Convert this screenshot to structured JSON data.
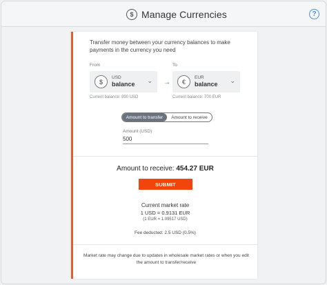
{
  "header": {
    "title": "Manage Currencies",
    "icon": "currency-exchange-icon",
    "help_icon": "help-icon"
  },
  "intro_text": "Transfer money between your currency balances to make payments in the currency you need",
  "from": {
    "label": "From",
    "symbol": "$",
    "code": "USD",
    "balance_label": "balance",
    "current_balance": "Current balance: 990 USD"
  },
  "to": {
    "label": "To",
    "symbol": "€",
    "code": "EUR",
    "balance_label": "balance",
    "current_balance": "Current balance: 700 EUR"
  },
  "toggle": {
    "amount_to_transfer": "Amount to transfer",
    "amount_to_receive": "Amount to receive",
    "selected": "amount_to_transfer"
  },
  "amount": {
    "label": "Amount (USD)",
    "value": "500"
  },
  "receive": {
    "label": "Amount to receive:",
    "value": "454.27 EUR"
  },
  "submit_label": "SUBMIT",
  "rate": {
    "title": "Current market rate",
    "main": "1 USD = 0.9131 EUR",
    "inverse": "(1 EUR = 1.09517 USD)"
  },
  "fee": "Fee deducted: 2.5 USD (0.5%)",
  "footnote": "Market rate may change due to updates in wholesale market rates or when you edit the amount to transfer/receive",
  "colors": {
    "accent": "#f0460c",
    "card_border": "#e65c2a",
    "toggle_active": "#6b7280"
  }
}
